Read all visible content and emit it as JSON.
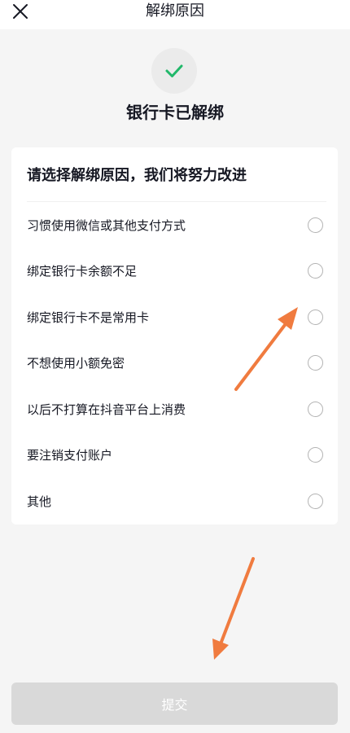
{
  "header": {
    "title": "解绑原因"
  },
  "status": {
    "message": "银行卡已解绑"
  },
  "reasons": {
    "title": "请选择解绑原因，我们将努力改进",
    "options": [
      "习惯使用微信或其他支付方式",
      "绑定银行卡余额不足",
      "绑定银行卡不是常用卡",
      "不想使用小额免密",
      "以后不打算在抖音平台上消费",
      "要注销支付账户",
      "其他"
    ]
  },
  "submit": {
    "label": "提交"
  },
  "colors": {
    "accent_check": "#21b86a",
    "annotation_arrow": "#f07b3f",
    "submit_disabled": "#d9d9d9"
  },
  "icons": {
    "close": "close-icon",
    "success": "checkmark-icon",
    "annotation": "arrow-annotation"
  }
}
